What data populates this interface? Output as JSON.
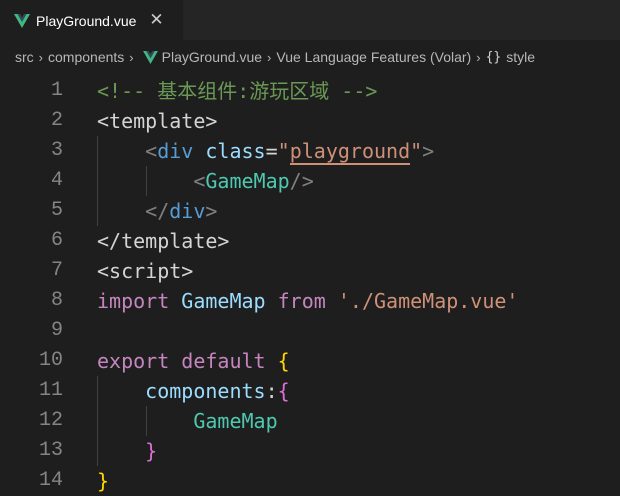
{
  "tab": {
    "title": "PlayGround.vue",
    "close_glyph": "✕",
    "icon": "vue-icon",
    "accent": "#41b883"
  },
  "breadcrumb": {
    "items": [
      "src",
      "components",
      "PlayGround.vue",
      "Vue Language Features (Volar)",
      "style"
    ],
    "separator": "›",
    "braces": "{}"
  },
  "editor": {
    "lines": [
      {
        "n": "1",
        "tokens": [
          [
            "c-comment",
            "<!-- 基本组件:游玩区域 -->"
          ]
        ]
      },
      {
        "n": "2",
        "tokens": [
          [
            "c-plain",
            "<template>"
          ]
        ]
      },
      {
        "n": "3",
        "tokens": [
          [
            "c-plain",
            "    "
          ],
          [
            "c-bracket",
            "<"
          ],
          [
            "c-tag",
            "div"
          ],
          [
            "c-plain",
            " "
          ],
          [
            "c-attr",
            "class"
          ],
          [
            "c-plain",
            "="
          ],
          [
            "c-str",
            "\""
          ],
          [
            "c-str u-str",
            "playground"
          ],
          [
            "c-str",
            "\""
          ],
          [
            "c-bracket",
            ">"
          ]
        ]
      },
      {
        "n": "4",
        "tokens": [
          [
            "c-plain",
            "        "
          ],
          [
            "c-bracket",
            "<"
          ],
          [
            "c-comp",
            "GameMap"
          ],
          [
            "c-bracket",
            "/>"
          ]
        ]
      },
      {
        "n": "5",
        "tokens": [
          [
            "c-plain",
            "    "
          ],
          [
            "c-bracket",
            "</"
          ],
          [
            "c-tag",
            "div"
          ],
          [
            "c-bracket",
            ">"
          ]
        ]
      },
      {
        "n": "6",
        "tokens": [
          [
            "c-plain",
            "</template>"
          ]
        ]
      },
      {
        "n": "7",
        "tokens": [
          [
            "c-plain",
            "<script>"
          ]
        ]
      },
      {
        "n": "8",
        "tokens": [
          [
            "c-kw",
            "import"
          ],
          [
            "c-plain",
            " "
          ],
          [
            "c-var",
            "GameMap"
          ],
          [
            "c-plain",
            " "
          ],
          [
            "c-kw",
            "from"
          ],
          [
            "c-plain",
            " "
          ],
          [
            "c-str",
            "'./GameMap.vue'"
          ]
        ]
      },
      {
        "n": "9",
        "tokens": []
      },
      {
        "n": "10",
        "tokens": [
          [
            "c-kw",
            "export"
          ],
          [
            "c-plain",
            " "
          ],
          [
            "c-kw",
            "default"
          ],
          [
            "c-plain",
            " "
          ],
          [
            "c-brace",
            "{"
          ]
        ]
      },
      {
        "n": "11",
        "tokens": [
          [
            "c-plain",
            "    "
          ],
          [
            "c-var",
            "components"
          ],
          [
            "c-plain",
            ":"
          ],
          [
            "c-brace2",
            "{"
          ]
        ]
      },
      {
        "n": "12",
        "tokens": [
          [
            "c-plain",
            "        "
          ],
          [
            "c-comp",
            "GameMap"
          ]
        ]
      },
      {
        "n": "13",
        "tokens": [
          [
            "c-plain",
            "    "
          ],
          [
            "c-brace2",
            "}"
          ]
        ]
      },
      {
        "n": "14",
        "tokens": [
          [
            "c-brace",
            "}"
          ]
        ]
      }
    ]
  }
}
